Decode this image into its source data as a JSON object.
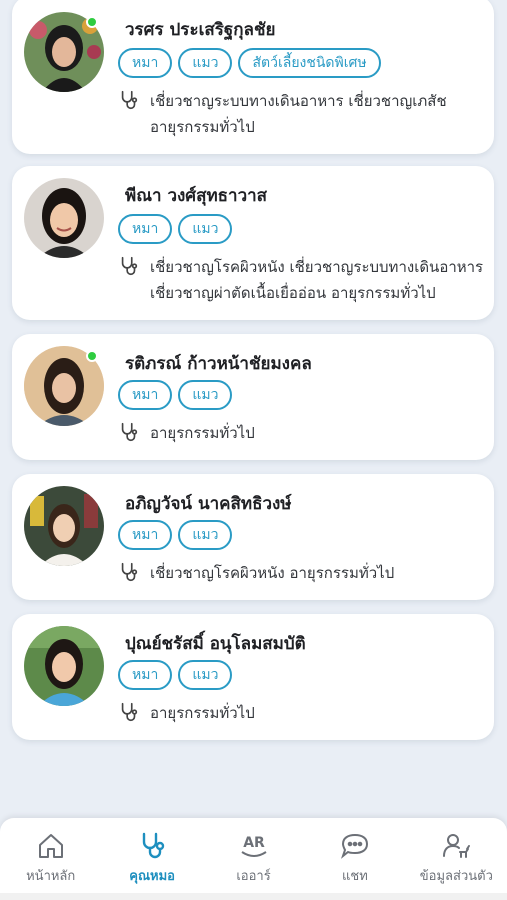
{
  "doctors": [
    {
      "name": "วรศร ประเสริฐกุลชัย",
      "online": true,
      "tags": [
        "หมา",
        "แมว",
        "สัตว์เลี้ยงชนิดพิเศษ"
      ],
      "specialties": "เชี่ยวชาญระบบทางเดินอาหาร เชี่ยวชาญเภสัช อายุรกรรมทั่วไป",
      "avatar": {
        "bg": "#6f8f5a",
        "hair": "#1b1b1b",
        "skin": "#e3b79a",
        "shirt": "#1a1a1a"
      }
    },
    {
      "name": "พีณา วงศ์สุทธาวาส",
      "online": false,
      "tags": [
        "หมา",
        "แมว"
      ],
      "specialties": "เชี่ยวชาญโรคผิวหนัง เชี่ยวชาญระบบทางเดินอาหาร เชี่ยวชาญผ่าตัดเนื้อเยื่ออ่อน อายุรกรรมทั่วไป",
      "avatar": {
        "bg": "#d9d4cf",
        "hair": "#1a1411",
        "skin": "#f0c8a8",
        "shirt": "#2b2b2b"
      }
    },
    {
      "name": "รติภรณ์ ก้าวหน้าชัยมงคล",
      "online": true,
      "tags": [
        "หมา",
        "แมว"
      ],
      "specialties": "อายุรกรรมทั่วไป",
      "avatar": {
        "bg": "#e8c9a0",
        "hair": "#2a1d16",
        "skin": "#e9c2a4",
        "shirt": "#4a5a6a"
      }
    },
    {
      "name": "อภิญวัจน์ นาคสิทธิวงษ์",
      "online": false,
      "tags": [
        "หมา",
        "แมว"
      ],
      "specialties": "เชี่ยวชาญโรคผิวหนัง อายุรกรรมทั่วไป",
      "avatar": {
        "bg": "#3c4a3a",
        "hair": "#3a261a",
        "skin": "#f0cfb3",
        "shirt": "#f4f1ec"
      }
    },
    {
      "name": "ปุณย์ชรัสมิ์ อนุโลมสมบัติ",
      "online": false,
      "tags": [
        "หมา",
        "แมว"
      ],
      "specialties": "อายุรกรรมทั่วไป",
      "avatar": {
        "bg": "#5d8a4a",
        "hair": "#1e1714",
        "skin": "#f1c9ab",
        "shirt": "#4aa6d8"
      }
    }
  ],
  "nav": [
    {
      "label": "หน้าหลัก",
      "icon": "home-icon",
      "active": false
    },
    {
      "label": "คุณหมอ",
      "icon": "stethoscope-icon",
      "active": true
    },
    {
      "label": "เออาร์",
      "icon": "ar-icon",
      "active": false
    },
    {
      "label": "แชท",
      "icon": "chat-icon",
      "active": false
    },
    {
      "label": "ข้อมูลส่วนตัว",
      "icon": "profile-pet-icon",
      "active": false
    }
  ],
  "ar_badge": "AR",
  "colors": {
    "accent": "#2a9bc5",
    "online": "#2ecc40",
    "nav_active": "#1e8fbf"
  }
}
